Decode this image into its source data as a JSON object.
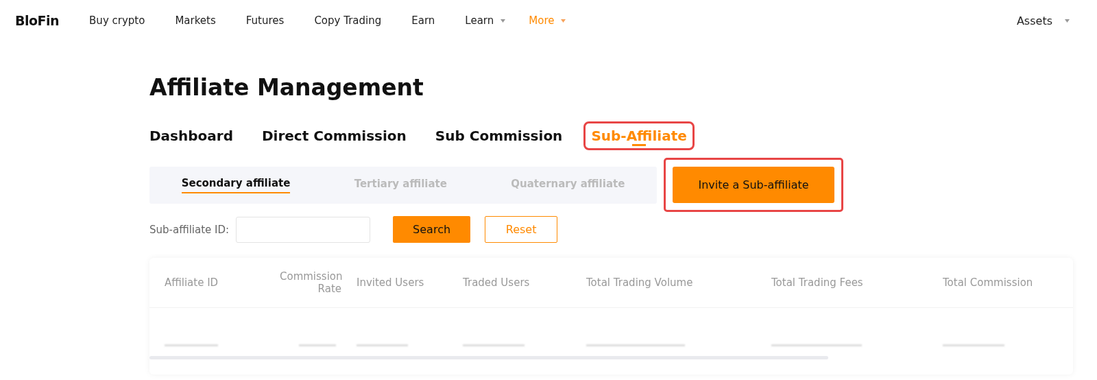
{
  "nav": {
    "logo": "BloFin",
    "items": [
      {
        "label": "Buy crypto",
        "selected": false,
        "dropdown": false
      },
      {
        "label": "Markets",
        "selected": false,
        "dropdown": false
      },
      {
        "label": "Futures",
        "selected": false,
        "dropdown": false
      },
      {
        "label": "Copy Trading",
        "selected": false,
        "dropdown": false
      },
      {
        "label": "Earn",
        "selected": false,
        "dropdown": false
      },
      {
        "label": "Learn",
        "selected": false,
        "dropdown": true
      },
      {
        "label": "More",
        "selected": true,
        "dropdown": true
      }
    ],
    "assets": {
      "label": "Assets",
      "dropdown": true
    }
  },
  "title": "Affiliate Management",
  "tabs": [
    {
      "label": "Dashboard",
      "selected": false,
      "highlighted": false
    },
    {
      "label": "Direct Commission",
      "selected": false,
      "highlighted": false
    },
    {
      "label": "Sub Commission",
      "selected": false,
      "highlighted": false
    },
    {
      "label": "Sub-Affiliate",
      "selected": true,
      "highlighted": true
    }
  ],
  "subtabs": [
    {
      "label": "Secondary affiliate",
      "selected": true
    },
    {
      "label": "Tertiary affiliate",
      "selected": false
    },
    {
      "label": "Quaternary affiliate",
      "selected": false
    }
  ],
  "invite_button": {
    "label": "Invite a Sub-affiliate",
    "highlighted": true
  },
  "filter": {
    "label": "Sub-affiliate ID:",
    "search": "Search",
    "reset": "Reset"
  },
  "table": {
    "columns": [
      "Affiliate ID",
      "Commission Rate",
      "Invited Users",
      "Traded Users",
      "Total Trading Volume",
      "Total Trading Fees",
      "Total Commission"
    ]
  }
}
